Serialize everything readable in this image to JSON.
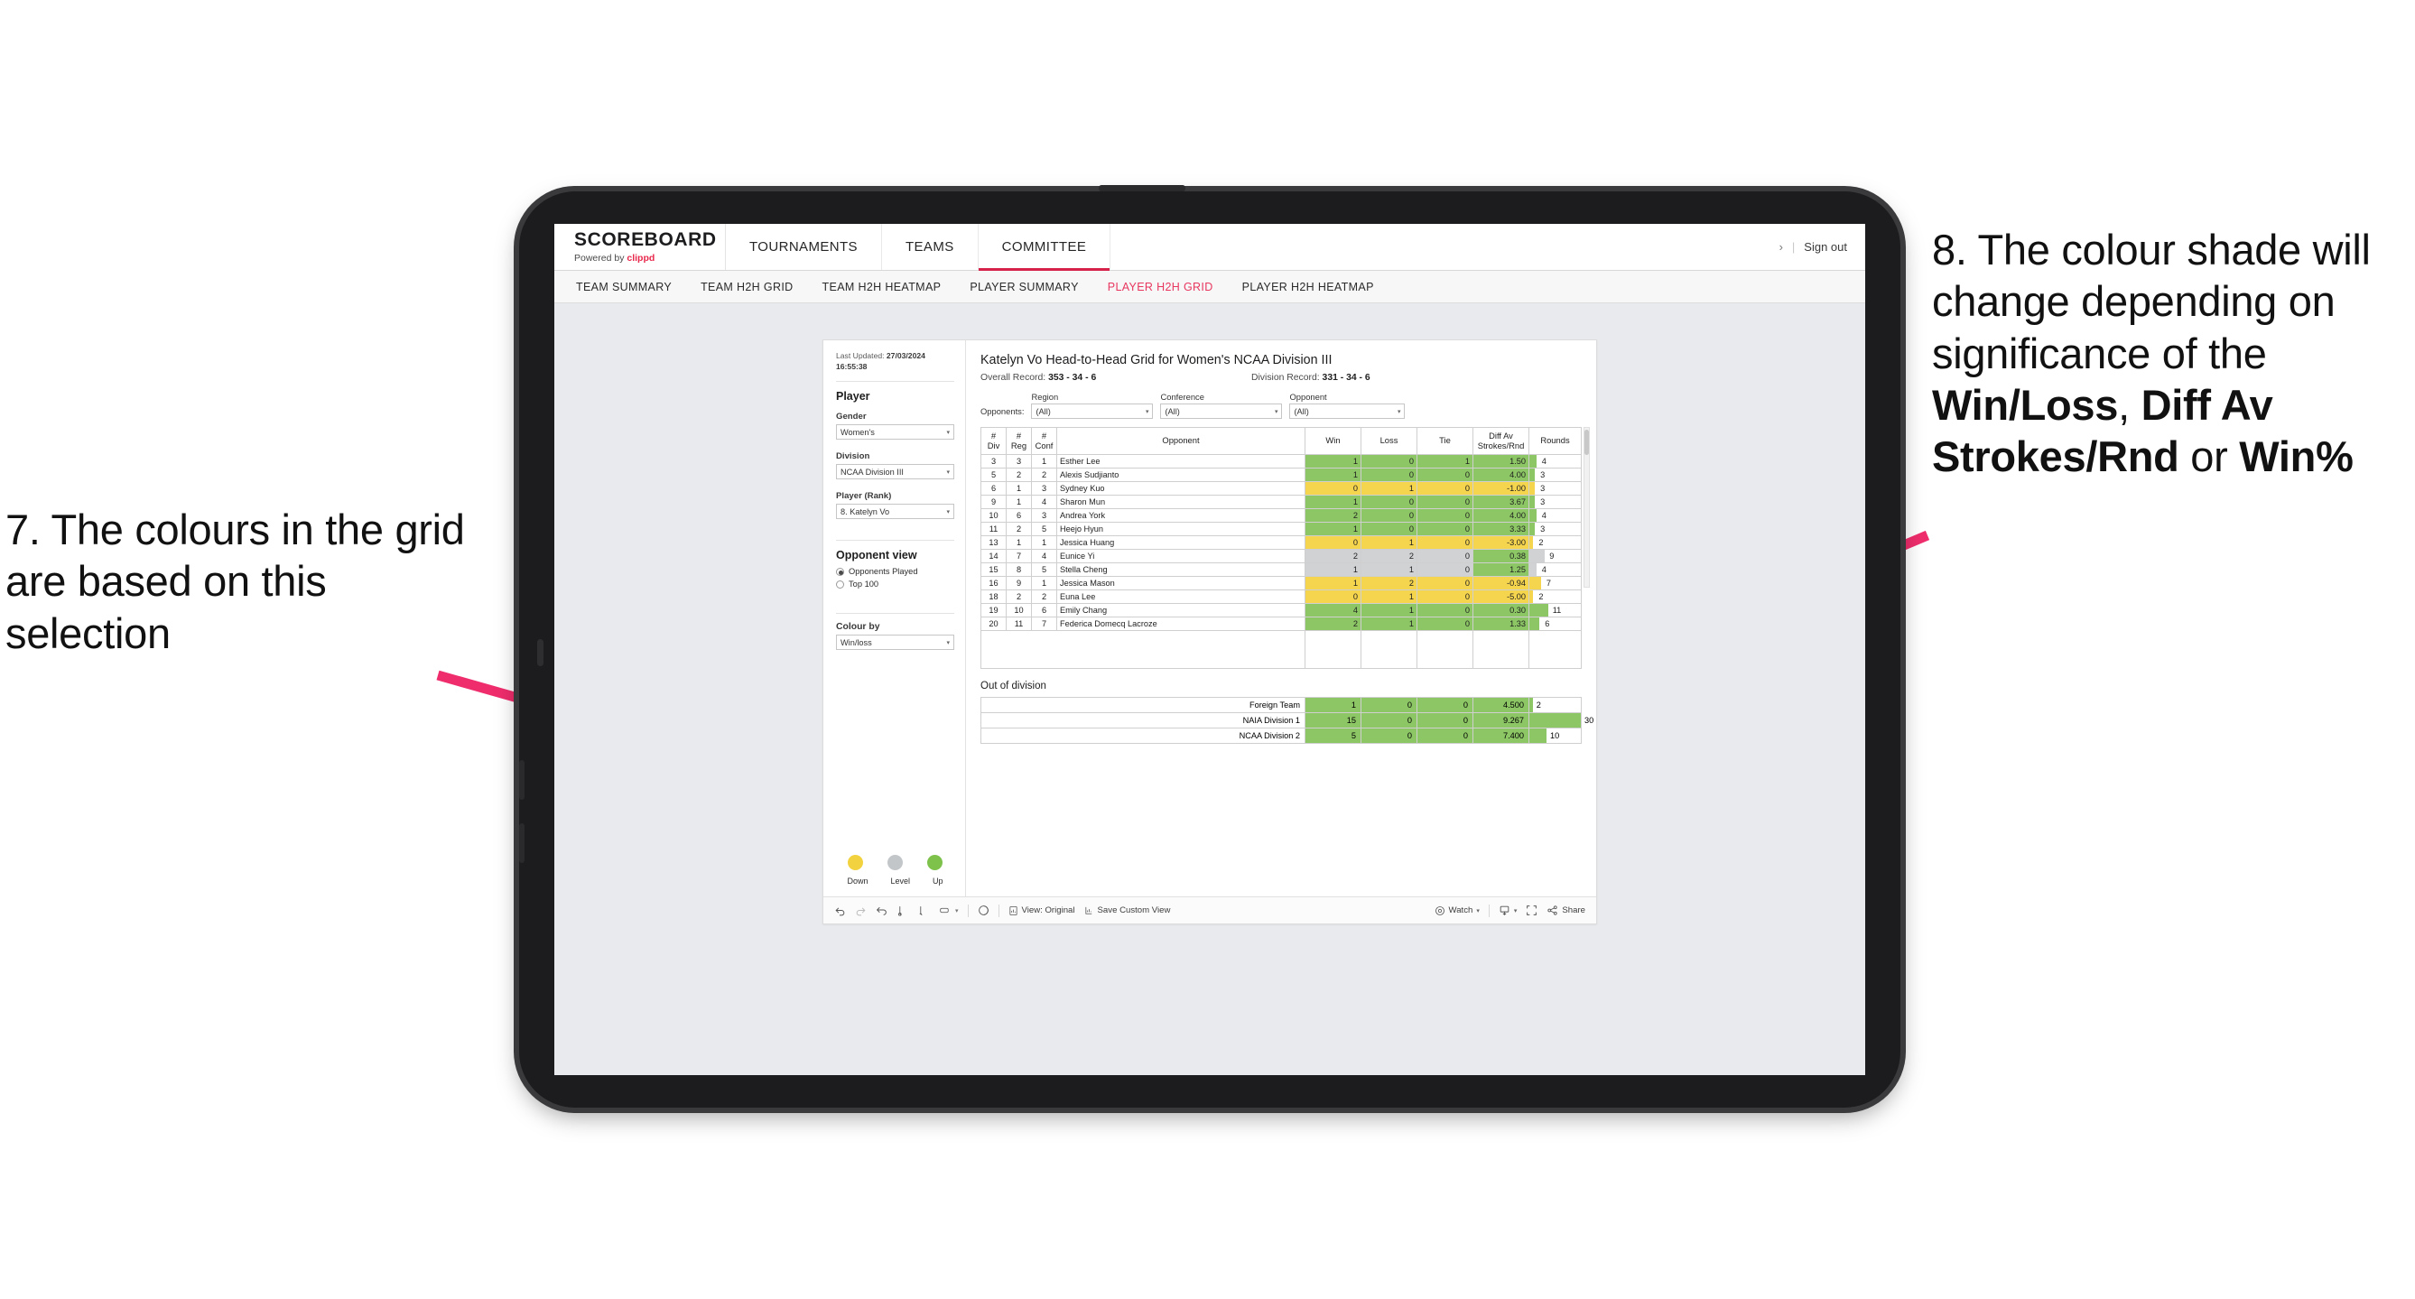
{
  "annotations": {
    "left": {
      "id": "7.",
      "text": "7. The colours in the grid are based on this selection"
    },
    "right": {
      "lead": "8. The colour shade will change depending on significance of the ",
      "bold1": "Win/Loss",
      "mid1": ", ",
      "bold2": "Diff Av Strokes/Rnd",
      "mid2": " or ",
      "bold3": "Win%"
    },
    "arrow_color": "#ef2d6d"
  },
  "header": {
    "brand_title": "SCOREBOARD",
    "brand_sub_prefix": "Powered by ",
    "brand_sub_link": "clippd",
    "nav": [
      {
        "label": "TOURNAMENTS",
        "active": false
      },
      {
        "label": "TEAMS",
        "active": false
      },
      {
        "label": "COMMITTEE",
        "active": true
      }
    ],
    "chevron": "›",
    "divider": "|",
    "sign_out": "Sign out"
  },
  "subnav": {
    "items": [
      {
        "label": "TEAM SUMMARY",
        "active": false
      },
      {
        "label": "TEAM H2H GRID",
        "active": false
      },
      {
        "label": "TEAM H2H HEATMAP",
        "active": false
      },
      {
        "label": "PLAYER SUMMARY",
        "active": false
      },
      {
        "label": "PLAYER H2H GRID",
        "active": true
      },
      {
        "label": "PLAYER H2H HEATMAP",
        "active": false
      }
    ]
  },
  "filter_panel": {
    "last_updated_label": "Last Updated:",
    "last_updated_value": "27/03/2024 16:55:38",
    "section_title": "Player",
    "gender": {
      "label": "Gender",
      "value": "Women's"
    },
    "division": {
      "label": "Division",
      "value": "NCAA Division III"
    },
    "player_rank": {
      "label": "Player (Rank)",
      "value": "8. Katelyn Vo"
    },
    "opponent_view": {
      "title": "Opponent view",
      "options": [
        {
          "label": "Opponents Played",
          "selected": true
        },
        {
          "label": "Top 100",
          "selected": false
        }
      ]
    },
    "colour_by": {
      "label": "Colour by",
      "value": "Win/loss"
    },
    "legend": {
      "items": [
        {
          "label": "Down",
          "color": "#f2d23f"
        },
        {
          "label": "Level",
          "color": "#c2c6c9"
        },
        {
          "label": "Up",
          "color": "#7ec24c"
        }
      ]
    }
  },
  "viz": {
    "title": "Katelyn Vo Head-to-Head Grid for Women's NCAA Division III",
    "overall_record_label": "Overall Record:",
    "overall_record_value": "353 -  34 - 6",
    "division_record_label": "Division Record:",
    "division_record_value": "331 -  34 - 6",
    "opponents_label": "Opponents:",
    "opponent_filters": [
      {
        "caption": "Region",
        "value": "(All)"
      },
      {
        "caption": "Conference",
        "value": "(All)"
      },
      {
        "caption": "Opponent",
        "value": "(All)"
      }
    ],
    "ood_title": "Out of division"
  },
  "chart_data": {
    "type": "table",
    "title": "Katelyn Vo Head-to-Head Grid for Women's NCAA Division III",
    "columns": [
      "# Div",
      "# Reg",
      "# Conf",
      "Opponent",
      "Win",
      "Loss",
      "Tie",
      "Diff Av Strokes/Rnd",
      "Rounds"
    ],
    "column_head_lines": [
      [
        "#",
        "Div"
      ],
      [
        "#",
        "Reg"
      ],
      [
        "#",
        "Conf"
      ],
      [
        "Opponent",
        ""
      ],
      [
        "Win",
        ""
      ],
      [
        "Loss",
        ""
      ],
      [
        "Tie",
        ""
      ],
      [
        "Diff Av",
        "Strokes/Rnd"
      ],
      [
        "Rounds",
        ""
      ]
    ],
    "max_rounds": 30,
    "rows": [
      {
        "div": "3",
        "reg": "3",
        "conf": "1",
        "opponent": "Esther Lee",
        "win": "1",
        "loss": "0",
        "tie": "1",
        "diff": "1.50",
        "rounds": "4",
        "shade": "up"
      },
      {
        "div": "5",
        "reg": "2",
        "conf": "2",
        "opponent": "Alexis Sudjianto",
        "win": "1",
        "loss": "0",
        "tie": "0",
        "diff": "4.00",
        "rounds": "3",
        "shade": "up"
      },
      {
        "div": "6",
        "reg": "1",
        "conf": "3",
        "opponent": "Sydney Kuo",
        "win": "0",
        "loss": "1",
        "tie": "0",
        "diff": "-1.00",
        "rounds": "3",
        "shade": "down"
      },
      {
        "div": "9",
        "reg": "1",
        "conf": "4",
        "opponent": "Sharon Mun",
        "win": "1",
        "loss": "0",
        "tie": "0",
        "diff": "3.67",
        "rounds": "3",
        "shade": "up"
      },
      {
        "div": "10",
        "reg": "6",
        "conf": "3",
        "opponent": "Andrea York",
        "win": "2",
        "loss": "0",
        "tie": "0",
        "diff": "4.00",
        "rounds": "4",
        "shade": "up"
      },
      {
        "div": "11",
        "reg": "2",
        "conf": "5",
        "opponent": "Heejo Hyun",
        "win": "1",
        "loss": "0",
        "tie": "0",
        "diff": "3.33",
        "rounds": "3",
        "shade": "up"
      },
      {
        "div": "13",
        "reg": "1",
        "conf": "1",
        "opponent": "Jessica Huang",
        "win": "0",
        "loss": "1",
        "tie": "0",
        "diff": "-3.00",
        "rounds": "2",
        "shade": "down"
      },
      {
        "div": "14",
        "reg": "7",
        "conf": "4",
        "opponent": "Eunice Yi",
        "win": "2",
        "loss": "2",
        "tie": "0",
        "diff": "0.38",
        "rounds": "9",
        "shade": "level",
        "diff_shade": "up"
      },
      {
        "div": "15",
        "reg": "8",
        "conf": "5",
        "opponent": "Stella Cheng",
        "win": "1",
        "loss": "1",
        "tie": "0",
        "diff": "1.25",
        "rounds": "4",
        "shade": "level",
        "diff_shade": "up"
      },
      {
        "div": "16",
        "reg": "9",
        "conf": "1",
        "opponent": "Jessica Mason",
        "win": "1",
        "loss": "2",
        "tie": "0",
        "diff": "-0.94",
        "rounds": "7",
        "shade": "down"
      },
      {
        "div": "18",
        "reg": "2",
        "conf": "2",
        "opponent": "Euna Lee",
        "win": "0",
        "loss": "1",
        "tie": "0",
        "diff": "-5.00",
        "rounds": "2",
        "shade": "down"
      },
      {
        "div": "19",
        "reg": "10",
        "conf": "6",
        "opponent": "Emily Chang",
        "win": "4",
        "loss": "1",
        "tie": "0",
        "diff": "0.30",
        "rounds": "11",
        "shade": "up"
      },
      {
        "div": "20",
        "reg": "11",
        "conf": "7",
        "opponent": "Federica Domecq Lacroze",
        "win": "2",
        "loss": "1",
        "tie": "0",
        "diff": "1.33",
        "rounds": "6",
        "shade": "up"
      }
    ],
    "out_of_division": {
      "title": "Out of division",
      "rows": [
        {
          "name": "Foreign Team",
          "win": "1",
          "loss": "0",
          "tie": "0",
          "diff": "4.500",
          "rounds": "2",
          "shade": "up"
        },
        {
          "name": "NAIA Division 1",
          "win": "15",
          "loss": "0",
          "tie": "0",
          "diff": "9.267",
          "rounds": "30",
          "shade": "up"
        },
        {
          "name": "NCAA Division 2",
          "win": "5",
          "loss": "0",
          "tie": "0",
          "diff": "7.400",
          "rounds": "10",
          "shade": "up"
        }
      ]
    },
    "colors": {
      "up": "#8dc765",
      "down": "#f5d44e",
      "level": "#d0d2d4",
      "up_light": "#a9d489"
    }
  },
  "toolbar": {
    "undo": "undo-icon",
    "redo": "redo-icon",
    "revert": "revert-icon",
    "refresh": "refresh-icon",
    "pause": "pause-icon",
    "view_original": "View: Original",
    "save_custom_view": "Save Custom View",
    "watch": "Watch",
    "share": "Share"
  }
}
